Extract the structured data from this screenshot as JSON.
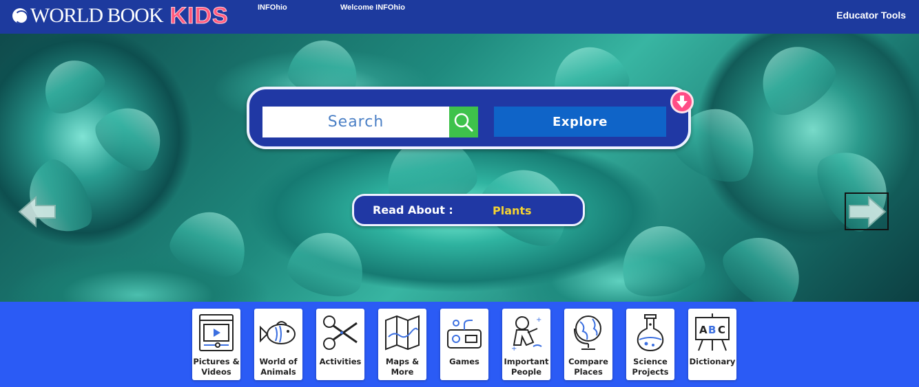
{
  "header": {
    "logo_text": "WORLD BOOK",
    "logo_kids": "KIDS",
    "account": "INFOhio",
    "welcome": "Welcome INFOhio",
    "educator_tools": "Educator Tools"
  },
  "search": {
    "placeholder": "Search",
    "explore_label": "Explore"
  },
  "read_about": {
    "label": "Read About :",
    "topic": "Plants"
  },
  "nav": {
    "tiles": [
      {
        "label": "Pictures & Videos",
        "icon": "video-player-icon"
      },
      {
        "label": "World of Animals",
        "icon": "fish-icon"
      },
      {
        "label": "Activities",
        "icon": "scissors-icon"
      },
      {
        "label": "Maps & More",
        "icon": "map-icon"
      },
      {
        "label": "Games",
        "icon": "game-controller-icon"
      },
      {
        "label": "Important People",
        "icon": "astronaut-icon"
      },
      {
        "label": "Compare Places",
        "icon": "globe-icon"
      },
      {
        "label": "Science Projects",
        "icon": "flask-icon"
      },
      {
        "label": "Dictionary",
        "icon": "abc-board-icon"
      }
    ]
  },
  "colors": {
    "header_bg": "#1d3a9e",
    "nav_bg": "#2b5bf5",
    "panel_bg": "#2038a4",
    "search_button": "#3ec24b",
    "explore_button": "#0f64c8",
    "kids_pink": "#ff5a7e",
    "topic_yellow": "#f6d431",
    "icon_blue": "#3b6fe0"
  }
}
